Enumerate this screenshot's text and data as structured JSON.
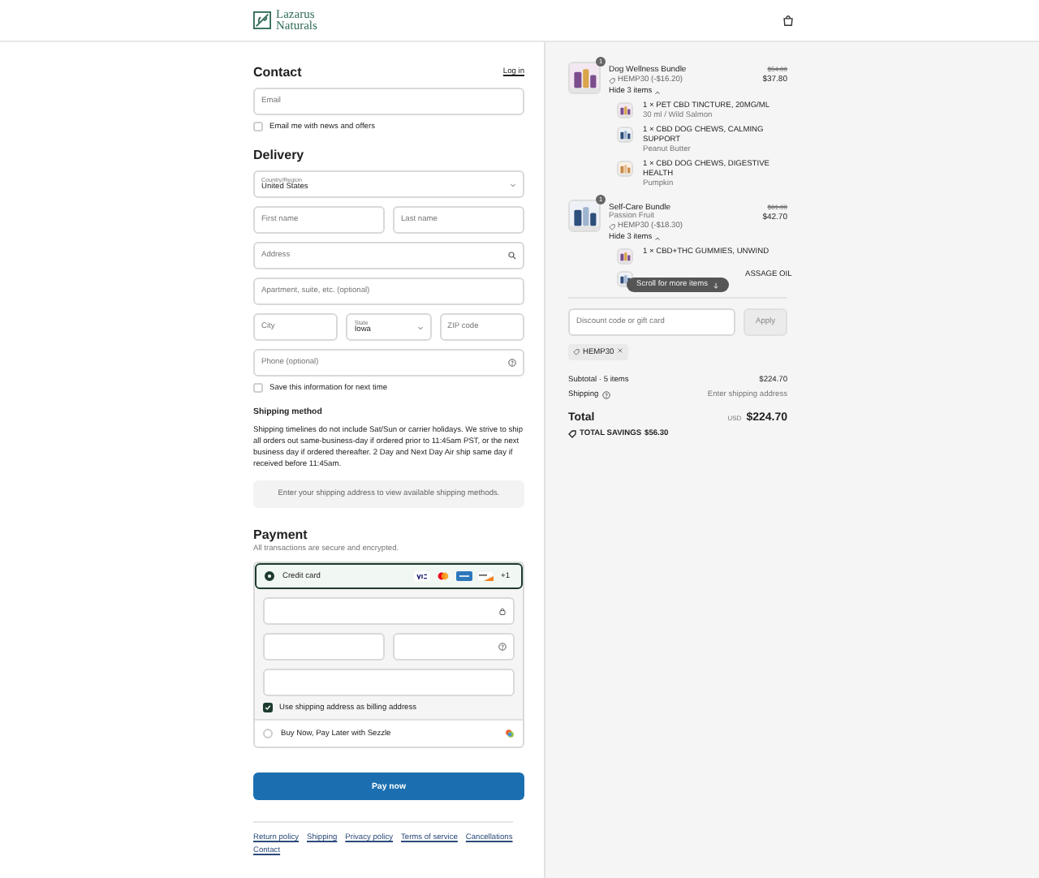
{
  "header": {
    "logo_line1": "Lazarus",
    "logo_line2": "Naturals"
  },
  "contact": {
    "heading": "Contact",
    "login_link": "Log in",
    "email": {
      "placeholder": "Email"
    },
    "news_checkbox": {
      "label": "Email me with news and offers",
      "checked": false
    }
  },
  "delivery": {
    "heading": "Delivery",
    "field_rows": [
      [
        {
          "kind": "select",
          "label": "Country/Region",
          "value": "United States"
        }
      ],
      [
        {
          "kind": "text",
          "placeholder": "First name"
        },
        {
          "kind": "text",
          "placeholder": "Last name"
        }
      ],
      [
        {
          "kind": "search",
          "placeholder": "Address"
        }
      ],
      [
        {
          "kind": "text",
          "placeholder": "Apartment, suite, etc. (optional)"
        }
      ],
      [
        {
          "kind": "text",
          "placeholder": "City"
        },
        {
          "kind": "select",
          "label": "State",
          "value": "Iowa"
        },
        {
          "kind": "text",
          "placeholder": "ZIP code"
        }
      ],
      [
        {
          "kind": "help",
          "placeholder": "Phone (optional)"
        }
      ]
    ],
    "save_checkbox": {
      "label": "Save this information for next time",
      "checked": false
    }
  },
  "shipping_method": {
    "heading": "Shipping method",
    "note": "Shipping timelines do not include Sat/Sun or carrier holidays. We strive to ship all orders out same-business-day if ordered prior to 11:45am PST, or the next business day if ordered thereafter. 2 Day and Next Day Air ship same day if received before 11:45am.",
    "notice": "Enter your shipping address to view available shipping methods."
  },
  "payment": {
    "heading": "Payment",
    "subtitle": "All transactions are secure and encrypted.",
    "methods": [
      {
        "kind": "card",
        "label": "Credit card",
        "selected": true,
        "more_cards": "+1"
      },
      {
        "kind": "sezzle",
        "label": "Buy Now, Pay Later with Sezzle",
        "selected": false
      }
    ],
    "billing_checkbox": {
      "label": "Use shipping address as billing address",
      "checked": true
    }
  },
  "pay_button": "Pay now",
  "footer_links": [
    "Return policy",
    "Shipping",
    "Privacy policy",
    "Terms of service",
    "Cancellations",
    "Contact"
  ],
  "order": {
    "items": [
      {
        "name": "Dog Wellness Bundle",
        "quantity": "1",
        "discount": "HEMP30 (-$16.20)",
        "original_price": "$54.00",
        "price": "$37.80",
        "toggle": "Hide 3 items",
        "children": [
          {
            "name": "1 × PET CBD TINCTURE, 20MG/ML",
            "variant": "30 ml / Wild Salmon"
          },
          {
            "name": "1 × CBD DOG CHEWS, CALMING SUPPORT",
            "variant": "Peanut Butter"
          },
          {
            "name": "1 × CBD DOG CHEWS, DIGESTIVE HEALTH",
            "variant": "Pumpkin"
          }
        ]
      },
      {
        "name": "Self-Care Bundle",
        "variant": "Passion Fruit",
        "quantity": "1",
        "discount": "HEMP30 (-$18.30)",
        "original_price": "$61.00",
        "price": "$42.70",
        "toggle": "Hide 3 items",
        "children": [
          {
            "name": "1 × CBD+THC GUMMIES, UNWIND"
          },
          {
            "name": "ASSAGE OIL",
            "hidden_start": true
          }
        ]
      }
    ],
    "scroll_hint": "Scroll for more items",
    "discount_field": {
      "placeholder": "Discount code or gift card"
    },
    "apply_button": "Apply",
    "applied_codes": [
      "HEMP30"
    ],
    "subtotal": {
      "label": "Subtotal · 5 items",
      "value": "$224.70"
    },
    "shipping": {
      "label": "Shipping",
      "value": "Enter shipping address"
    },
    "total": {
      "label": "Total",
      "currency": "USD",
      "value": "$224.70"
    },
    "savings": {
      "label": "TOTAL SAVINGS",
      "value": "$56.30"
    }
  }
}
